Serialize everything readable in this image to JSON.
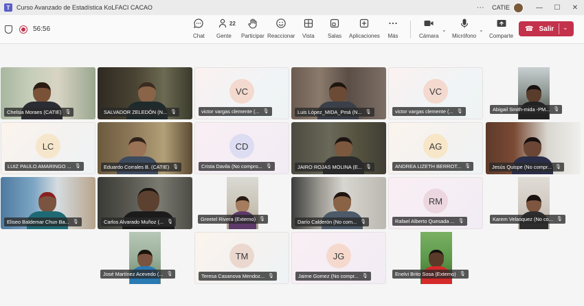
{
  "window": {
    "title": "Curso Avanzado de Estadística KoLFACI CACAO",
    "user": "CATIE",
    "more": "···",
    "controls": {
      "minimize": "—",
      "maximize": "☐",
      "close": "✕"
    }
  },
  "meeting": {
    "timer": "56:56"
  },
  "toolbar": {
    "chat": {
      "label": "Chat",
      "icon": "chat-icon"
    },
    "people": {
      "label": "Gente",
      "count": "22",
      "icon": "people-icon"
    },
    "raise": {
      "label": "Participar",
      "icon": "raise-hand-icon"
    },
    "react": {
      "label": "Reaccionar",
      "icon": "smile-icon"
    },
    "view": {
      "label": "Vista",
      "icon": "grid-icon"
    },
    "rooms": {
      "label": "Salas",
      "icon": "rooms-icon"
    },
    "apps": {
      "label": "Aplicaciones",
      "icon": "plus-icon"
    },
    "more": {
      "label": "Más",
      "icon": "more-icon"
    },
    "camera": {
      "label": "Cámara",
      "icon": "camera-icon"
    },
    "mic": {
      "label": "Micrófono",
      "icon": "mic-icon"
    },
    "share": {
      "label": "Comparte",
      "icon": "share-icon"
    },
    "leave": {
      "label": "Salir",
      "icon": "phone-icon"
    }
  },
  "participants": [
    {
      "name": "Chelsia Moraes (CATIE)",
      "initials": "",
      "type": "video"
    },
    {
      "name": "SALVADOR ZELEDÓN (N...",
      "initials": "",
      "type": "video"
    },
    {
      "name": "victor vargas clemente (...",
      "initials": "VC",
      "type": "avatar"
    },
    {
      "name": "Luis López_MIDA_Pmá (N...",
      "initials": "",
      "type": "video"
    },
    {
      "name": "victor vargas clemente (...",
      "initials": "VC",
      "type": "avatar"
    },
    {
      "name": "Abigail Smith-mida -PM...",
      "initials": "",
      "type": "video"
    },
    {
      "name": "LUIZ PAULO AMARINGO ...",
      "initials": "LC",
      "type": "avatar"
    },
    {
      "name": "Eduardo Corrales B. (CATIE)",
      "initials": "",
      "type": "video"
    },
    {
      "name": "Crista Davila (No compro...",
      "initials": "CD",
      "type": "avatar"
    },
    {
      "name": "JAIRO ROJAS MOLINA (E...",
      "initials": "",
      "type": "video"
    },
    {
      "name": "ANDREA LIZETH BERROT...",
      "initials": "AG",
      "type": "avatar"
    },
    {
      "name": "Jesús Quispe (No compr...",
      "initials": "",
      "type": "video"
    },
    {
      "name": "Eliseo Baldemar Chun Ba...",
      "initials": "",
      "type": "video"
    },
    {
      "name": "Carlos Alvarado Muñoz (...",
      "initials": "",
      "type": "video"
    },
    {
      "name": "Greetel Rivera (Externo)",
      "initials": "",
      "type": "video"
    },
    {
      "name": "Darío Calderón (No com...",
      "initials": "",
      "type": "video"
    },
    {
      "name": "Rafael Alberto Quesada ...",
      "initials": "RM",
      "type": "avatar"
    },
    {
      "name": "Karem Velasquez (No co...",
      "initials": "",
      "type": "video"
    },
    {
      "name": "José Martínez Acevedo (...",
      "initials": "",
      "type": "video"
    },
    {
      "name": "Teresa Casanova Mendoz...",
      "initials": "TM",
      "type": "avatar"
    },
    {
      "name": "Jaime Gomez (No compr...",
      "initials": "JG",
      "type": "avatar"
    },
    {
      "name": "Enelvi Brito Sosa (Externo)",
      "initials": "",
      "type": "video"
    }
  ],
  "colors": {
    "accent": "#5b5fc7",
    "leave": "#c4314b",
    "avatar_vc": "#f4d9cf",
    "avatar_lc": "#f6e6cc",
    "avatar_cd": "#dcdcf2",
    "avatar_ag": "#f7e6c8",
    "avatar_rm": "#ecd6df",
    "avatar_tm": "#ead8cf",
    "avatar_jg": "#f6d9cd"
  }
}
